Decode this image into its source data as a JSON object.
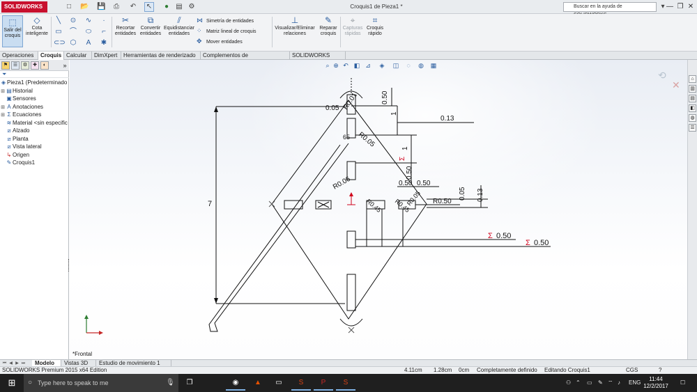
{
  "titlebar": {
    "app_name": "SOLIDWORKS",
    "doc_title": "Croquis1 de Pieza1 *",
    "help_search_placeholder": "Buscar en la ayuda de SOLIDWORKS",
    "min": "—",
    "restore": "❐",
    "close": "✕"
  },
  "cmd": {
    "exit_sketch": "Salir del croquis",
    "smart_dim": "Cota inteligente",
    "trim": "Recortar entidades",
    "convert": "Convertir entidades",
    "offset": "Equidistanciar entidades",
    "mirror": "Simetría de entidades",
    "linear_pattern": "Matriz lineal de croquis",
    "move": "Mover entidades",
    "show_relations": "Visualizar/Eliminar relaciones",
    "repair": "Reparar croquis",
    "rapid_captures": "Capturas rápidas",
    "quick_sketch": "Croquis rápido"
  },
  "tabs": [
    "Operaciones",
    "Croquis",
    "Calcular",
    "DimXpert",
    "Herramientas de renderizado",
    "Complementos de SOLIDWORKS",
    "SOLIDWORKS MBD"
  ],
  "tree": {
    "root": "Pieza1  (Predeterminado",
    "items": [
      "Historial",
      "Sensores",
      "Anotaciones",
      "Ecuaciones",
      "Material <sin especific",
      "Alzado",
      "Planta",
      "Vista lateral",
      "Origen",
      "Croquis1"
    ]
  },
  "graphics": {
    "view_label": "*Frontal",
    "dims": {
      "overall_height": "7",
      "top_050": "0.50",
      "top_1": "1",
      "top_005": "0.05",
      "r001": "R0.01",
      "r005": "R0.05",
      "d013_top": "0.13",
      "v050": "0.50",
      "v1": "1",
      "sigma": "Σ",
      "r006": "R0.06",
      "h050a": "0.50",
      "h050b": "0.50",
      "r050_right": "R0.50",
      "d005_right": "0.05",
      "d013_right": "0.13",
      "r045a": "R0.45",
      "r045b": "R0.45",
      "r005b": "R0.05",
      "sigma_050_a": "0.50",
      "sigma_050_b": "0.50",
      "dim_65": "65"
    }
  },
  "modeltabs": [
    "Modelo",
    "Vistas 3D",
    "Estudio de movimiento 1"
  ],
  "status": {
    "edition": "SOLIDWORKS Premium 2015 x64 Edition",
    "x": "4.11cm",
    "y": "1.28cm",
    "z": "0cm",
    "state": "Completamente definido",
    "editing": "Editando Croquis1",
    "units": "CGS"
  },
  "taskbar": {
    "cortana": "Type here to speak to me",
    "lang": "ENG",
    "time": "11:44",
    "date": "12/2/2017"
  },
  "colors": {
    "sketch_line": "#111111",
    "origin": "#d0021b",
    "sigma": "#d0021b",
    "axis_y": "#2e7d32",
    "axis_x": "#c62828"
  }
}
